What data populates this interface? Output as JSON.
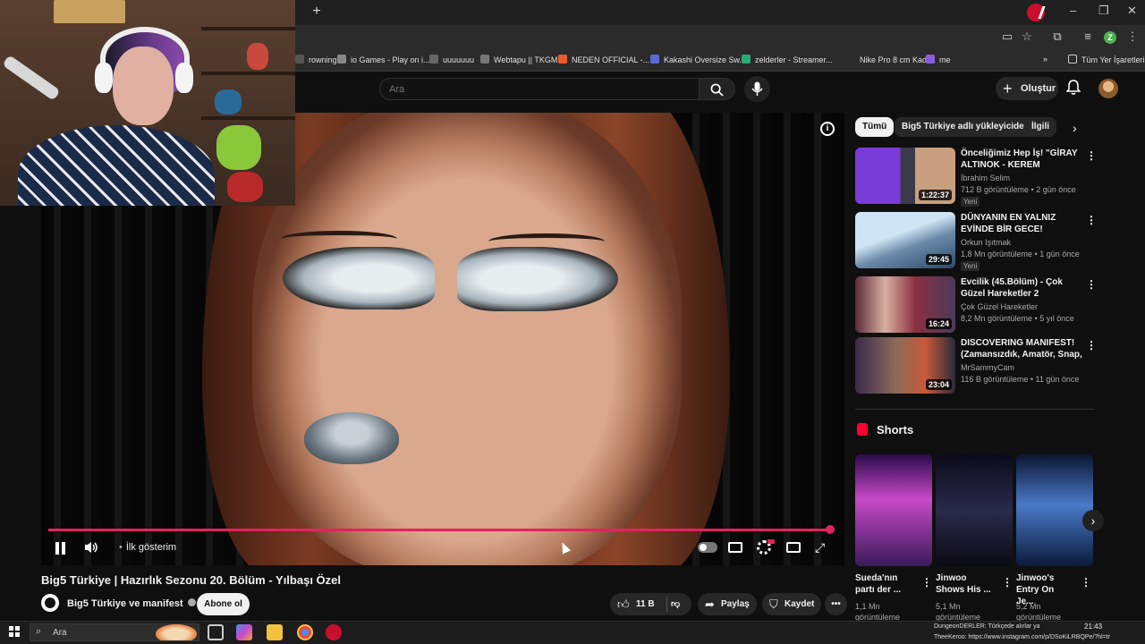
{
  "browser": {
    "new_tab_label": "+",
    "bookmarks": [
      {
        "label": "rowning...",
        "color": "#555555"
      },
      {
        "label": "io Games - Play on i...",
        "color": "#888888"
      },
      {
        "label": "uuuuuuu",
        "color": "#666666"
      },
      {
        "label": "Webtapu || TKGM",
        "color": "#777777"
      },
      {
        "label": "NEDEN OFFICIAL -...",
        "color": "#e85c2c"
      },
      {
        "label": "Kakashi Oversize Sw...",
        "color": "#5a6bd8"
      },
      {
        "label": "zelderler - Streamer...",
        "color": "#2aa876"
      },
      {
        "label": "Nike Pro 8 cm Kadı...",
        "color": "#2b2b2b"
      },
      {
        "label": "me",
        "color": "#8a5cd8"
      }
    ],
    "all_bookmarks_label": "Tüm Yer İşaretleri",
    "profile_initial": "Z"
  },
  "header": {
    "search_placeholder": "Ara",
    "create_label": "Oluştur"
  },
  "player": {
    "chapter_label": "İlk gösterim",
    "progress_fraction": 0.995
  },
  "video": {
    "title": "Big5 Türkiye | Hazırlık Sezonu 20. Bölüm - Yılbaşı Özel",
    "channel": "Big5 Türkiye ve manifest",
    "subscribe_label": "Abone ol",
    "like_count": "11 B",
    "share_label": "Paylaş",
    "save_label": "Kaydet",
    "more_label": "•••"
  },
  "sidebar": {
    "chips": [
      "Tümü",
      "Big5 Türkiye adlı yükleyiciden",
      "İlgili"
    ],
    "recommendations": [
      {
        "title": "Önceliğimiz Hep İş! \"GİRAY ALTINOK - KEREM ÖZDOĞAN\" ...",
        "channel": "İbrahim Selim",
        "meta": "712 B görüntüleme • 2 gün önce",
        "badge": "Yeni",
        "duration": "1:22:37"
      },
      {
        "title": "DÜNYANIN EN YALNIZ EVİNDE BİR GECE!",
        "channel": "Orkun Işıtmak",
        "meta": "1,8 Mn görüntüleme • 1 gün önce",
        "badge": "Yeni",
        "duration": "29:45"
      },
      {
        "title": "Evcilik (45.Bölüm) - Çok Güzel Hareketler 2",
        "channel": "Çok Güzel Hareketler",
        "meta": "8,2 Mn görüntüleme • 5 yıl önce",
        "badge": "",
        "duration": "16:24"
      },
      {
        "title": "DISCOVERING MANIFEST! (Zamansızdık, Amatör, Snap, ...",
        "channel": "MrSammyCam",
        "meta": "116 B görüntüleme • 11 gün önce",
        "badge": "",
        "duration": "23:04"
      }
    ],
    "shorts_title": "Shorts",
    "shorts": [
      {
        "title": "Sueda'nın partı der ...",
        "meta": "1,1 Mn görüntüleme"
      },
      {
        "title": "Jinwoo Shows His ...",
        "meta": "5,1 Mn görüntüleme"
      },
      {
        "title": "Jinwoo's Entry On Je...",
        "meta": "5,2 Mn görüntüleme"
      }
    ]
  },
  "taskbar": {
    "search_label": "Ara",
    "tray_line1": "DungeonDERLER: Türkçede alırlar ya",
    "tray_line2": "TheeKeroo: https://www.instagram.com/p/DSoKiLRBQPe/?hl=tr",
    "time": "21:43"
  }
}
